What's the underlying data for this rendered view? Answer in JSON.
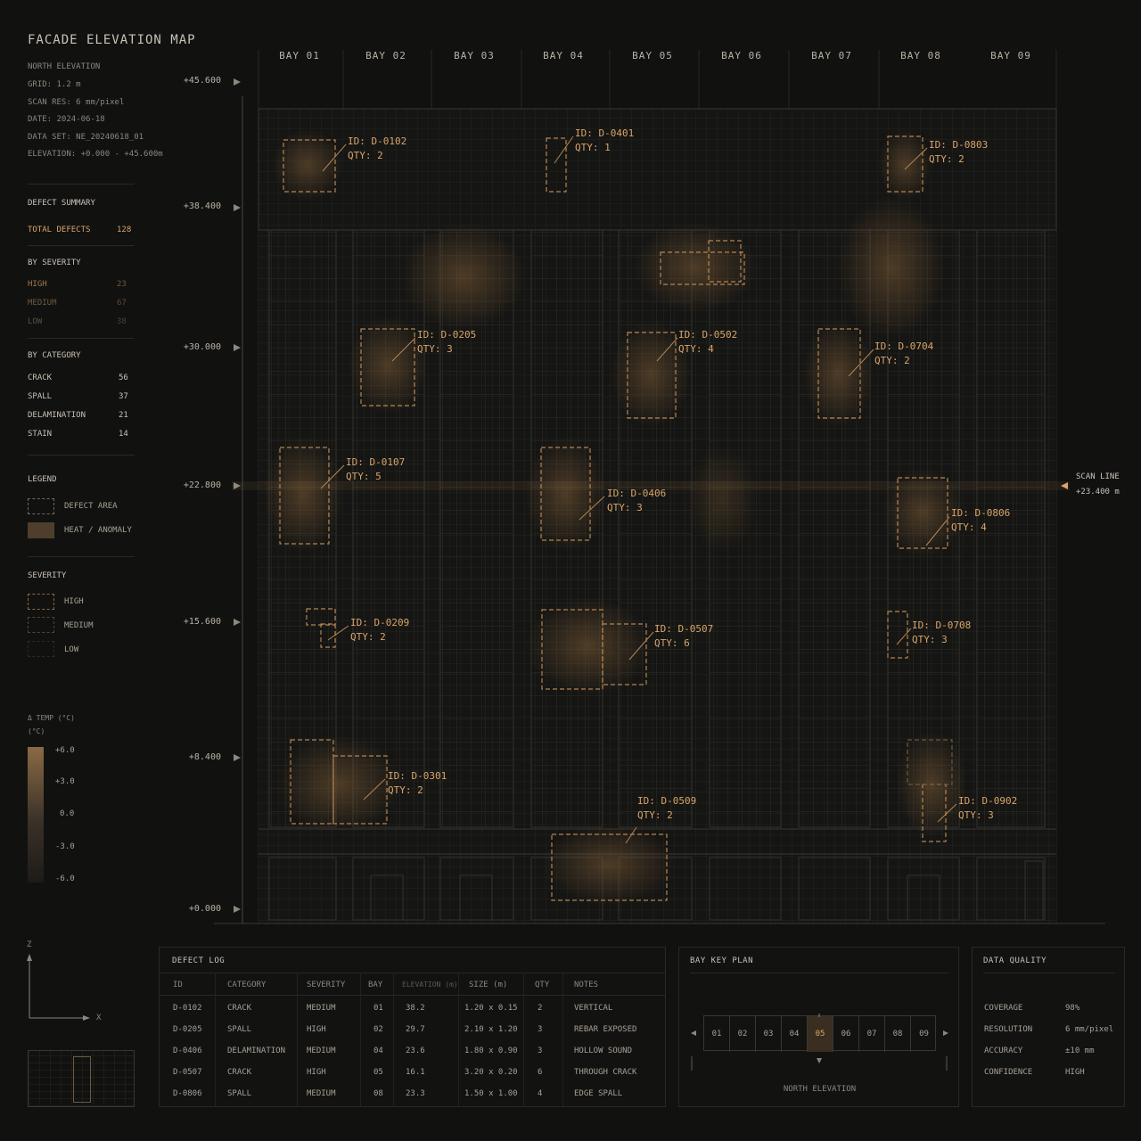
{
  "header": {
    "title": "FACADE ELEVATION MAP",
    "meta": [
      "NORTH ELEVATION",
      "GRID: 1.2 m",
      "SCAN RES: 6 mm/pixel",
      "DATE: 2024-06-18",
      "DATA SET: NE_20240618_01",
      "ELEVATION: +0.000 - +45.600m"
    ]
  },
  "summary": {
    "heading": "DEFECT SUMMARY",
    "total_label": "TOTAL DEFECTS",
    "total_value": "128",
    "severity_heading": "BY SEVERITY",
    "severity": [
      {
        "label": "HIGH",
        "value": "23"
      },
      {
        "label": "MEDIUM",
        "value": "67"
      },
      {
        "label": "LOW",
        "value": "38"
      }
    ],
    "category_heading": "BY CATEGORY",
    "category": [
      {
        "label": "CRACK",
        "value": "56"
      },
      {
        "label": "SPALL",
        "value": "37"
      },
      {
        "label": "DELAMINATION",
        "value": "21"
      },
      {
        "label": "STAIN",
        "value": "14"
      }
    ]
  },
  "legend": {
    "heading": "LEGEND",
    "defect_area": "DEFECT AREA",
    "heat": "HEAT / ANOMALY",
    "severity_heading": "SEVERITY",
    "high": "HIGH",
    "medium": "MEDIUM",
    "low": "LOW"
  },
  "temp_scale": {
    "label": "Δ TEMP (°C)",
    "unit": "(°C)",
    "ticks": [
      "+6.0",
      "+3.0",
      "0.0",
      "-3.0",
      "-6.0"
    ]
  },
  "axes": {
    "z": "Z",
    "x": "X"
  },
  "bays": [
    "BAY 01",
    "BAY 02",
    "BAY 03",
    "BAY 04",
    "BAY 05",
    "BAY 06",
    "BAY 07",
    "BAY 08",
    "BAY 09"
  ],
  "elevations": [
    "+45.600",
    "+38.400",
    "+30.000",
    "+22.800",
    "+15.600",
    "+8.400",
    "+0.000"
  ],
  "scan_line": {
    "label": "SCAN LINE",
    "value": "+23.400 m"
  },
  "defects": [
    {
      "id": "ID: D-0102",
      "qty": "QTY: 2"
    },
    {
      "id": "ID: D-0401",
      "qty": "QTY: 1"
    },
    {
      "id": "ID: D-0803",
      "qty": "QTY: 2"
    },
    {
      "id": "ID: D-0205",
      "qty": "QTY: 3"
    },
    {
      "id": "ID: D-0502",
      "qty": "QTY: 4"
    },
    {
      "id": "ID: D-0704",
      "qty": "QTY: 2"
    },
    {
      "id": "ID: D-0107",
      "qty": "QTY: 5"
    },
    {
      "id": "ID: D-0406",
      "qty": "QTY: 3"
    },
    {
      "id": "ID: D-0806",
      "qty": "QTY: 4"
    },
    {
      "id": "ID: D-0209",
      "qty": "QTY: 2"
    },
    {
      "id": "ID: D-0507",
      "qty": "QTY: 6"
    },
    {
      "id": "ID: D-0708",
      "qty": "QTY: 3"
    },
    {
      "id": "ID: D-0301",
      "qty": "QTY: 2"
    },
    {
      "id": "ID: D-0509",
      "qty": "QTY: 2"
    },
    {
      "id": "ID: D-0902",
      "qty": "QTY: 3"
    }
  ],
  "defect_log": {
    "heading": "DEFECT LOG",
    "columns": [
      "ID",
      "CATEGORY",
      "SEVERITY",
      "BAY",
      "ELEVATION (m)",
      "SIZE (m)",
      "QTY",
      "NOTES"
    ],
    "rows": [
      [
        "D-0102",
        "CRACK",
        "MEDIUM",
        "01",
        "38.2",
        "1.20 x 0.15",
        "2",
        "VERTICAL"
      ],
      [
        "D-0205",
        "SPALL",
        "HIGH",
        "02",
        "29.7",
        "2.10 x 1.20",
        "3",
        "REBAR EXPOSED"
      ],
      [
        "D-0406",
        "DELAMINATION",
        "MEDIUM",
        "04",
        "23.6",
        "1.80 x 0.90",
        "3",
        "HOLLOW SOUND"
      ],
      [
        "D-0507",
        "CRACK",
        "HIGH",
        "05",
        "16.1",
        "3.20 x 0.20",
        "6",
        "THROUGH CRACK"
      ],
      [
        "D-0806",
        "SPALL",
        "MEDIUM",
        "08",
        "23.3",
        "1.50 x 1.00",
        "4",
        "EDGE SPALL"
      ]
    ]
  },
  "key_plan": {
    "heading": "BAY KEY PLAN",
    "bays": [
      "01",
      "02",
      "03",
      "04",
      "05",
      "06",
      "07",
      "08",
      "09"
    ],
    "selected": "05",
    "caption": "NORTH ELEVATION"
  },
  "data_quality": {
    "heading": "DATA QUALITY",
    "rows": [
      {
        "label": "COVERAGE",
        "value": "98%"
      },
      {
        "label": "RESOLUTION",
        "value": "6 mm/pixel"
      },
      {
        "label": "ACCURACY",
        "value": "±10 mm"
      },
      {
        "label": "CONFIDENCE",
        "value": "HIGH"
      }
    ]
  },
  "colors": {
    "accent": "#d9a56a",
    "background": "#111110",
    "grid": "#3a3732"
  }
}
